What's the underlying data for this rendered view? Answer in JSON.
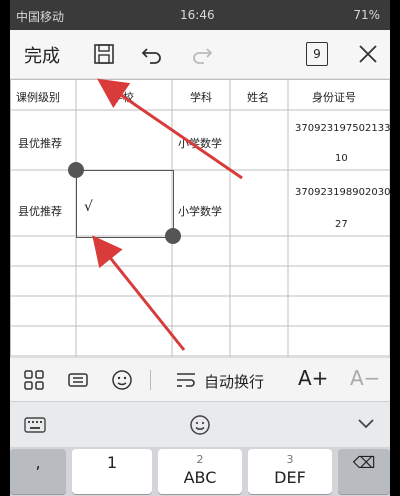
{
  "status_bar": {
    "carrier": "中国移动",
    "time": "16:46",
    "right_status": "71%"
  },
  "toolbar": {
    "done_label": "完成",
    "tab_count": "9",
    "icons": [
      "save-icon",
      "undo-icon",
      "redo-icon",
      "tabs-icon",
      "close-icon"
    ]
  },
  "sheet": {
    "headers": [
      "课例级别",
      "学校",
      "学科",
      "姓名",
      "身份证号"
    ],
    "rows": [
      {
        "level": "县优推荐",
        "school": "",
        "subject": "小学数学",
        "name": "",
        "id_line1": "370923197502133 1",
        "id_line2": "10"
      },
      {
        "level": "县优推荐",
        "school": "√",
        "subject": "小学数学",
        "name": "",
        "id_line1": "370923198902030 0",
        "id_line2": "27"
      }
    ]
  },
  "format_bar": {
    "wrap_label": "自动换行",
    "font_increase": "A+",
    "font_decrease": "A−",
    "icons": [
      "grid-icon",
      "keyboard-switch-icon",
      "emoji-icon",
      "wrap-icon",
      "font-increase-icon",
      "font-decrease-icon"
    ]
  },
  "keyboard": {
    "toolbar_icons": [
      "keyboard-icon",
      "smiley-icon",
      "chevron-down-icon"
    ],
    "keys": [
      {
        "main": ",",
        "sub": ""
      },
      {
        "main": "1",
        "sub": ""
      },
      {
        "main": "ABC",
        "sub": "2"
      },
      {
        "main": "DEF",
        "sub": "3"
      },
      {
        "main": "⌫",
        "sub": ""
      }
    ]
  },
  "colors": {
    "arrow": "#d93a3a",
    "status_bar": "#3a3a3a",
    "handle": "#555555"
  }
}
